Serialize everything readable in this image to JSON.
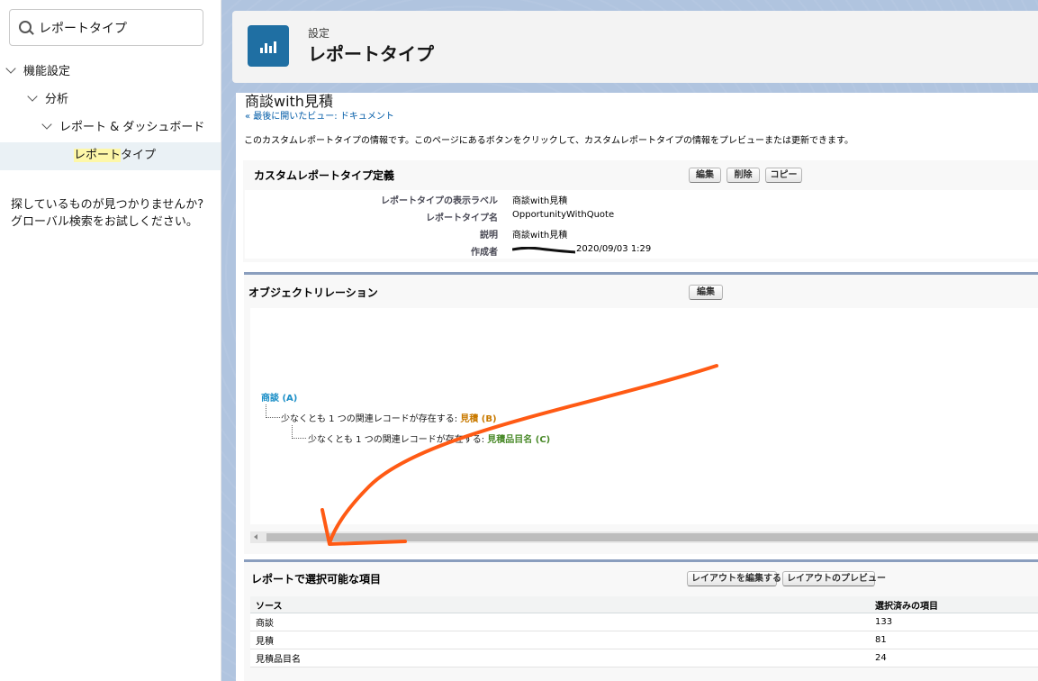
{
  "sidebar": {
    "search": {
      "value": "レポートタイプ",
      "placeholder": ""
    },
    "tree": [
      {
        "label": "機能設定"
      },
      {
        "label": "分析"
      },
      {
        "label": "レポート & ダッシュボード"
      }
    ],
    "leaf": {
      "label_highlight": "レポート",
      "label_rest": "タイプ"
    },
    "not_found_line1": "探しているものが見つかりませんか?",
    "not_found_line2": "グローバル検索をお試しください。"
  },
  "header": {
    "subtitle": "設定",
    "title": "レポートタイプ",
    "icon": "report-chart-icon"
  },
  "record": {
    "title": "商談with見積",
    "back_link": "« 最後に開いたビュー: ドキュメント",
    "description": "このカスタムレポートタイプの情報です。このページにあるボタンをクリックして、カスタムレポートタイプの情報をプレビューまたは更新できます。"
  },
  "definition": {
    "title": "カスタムレポートタイプ定義",
    "buttons": {
      "edit": "編集",
      "delete": "削除",
      "copy": "コピー"
    },
    "rows": [
      {
        "label": "レポートタイプの表示ラベル",
        "value": "商談with見積"
      },
      {
        "label": "レポートタイプ名",
        "value": "OpportunityWithQuote"
      },
      {
        "label": "説明",
        "value": "商談with見積"
      },
      {
        "label": "作成者",
        "value": "2020/09/03 1:29"
      }
    ]
  },
  "relations": {
    "title": "オブジェクトリレーション",
    "edit_button": "編集",
    "object_a": "商談 (A)",
    "rel_b_prefix": "少なくとも 1 つの関連レコードが存在する: ",
    "object_b": "見積 (B)",
    "rel_c_prefix": "少なくとも 1 つの関連レコードが存在する: ",
    "object_c": "見積品目名 (C)"
  },
  "fields": {
    "title": "レポートで選択可能な項目",
    "buttons": {
      "edit_layout": "レイアウトを編集する",
      "preview_layout": "レイアウトのプレビュー"
    },
    "columns": [
      "ソース",
      "選択済みの項目"
    ],
    "rows": [
      [
        "商談",
        "133"
      ],
      [
        "見積",
        "81"
      ],
      [
        "見積品目名",
        "24"
      ]
    ]
  },
  "colors": {
    "brand_icon": "#1f6fa3",
    "annotation_arrow": "#ff5a14",
    "highlight": "#fdf7a8"
  }
}
